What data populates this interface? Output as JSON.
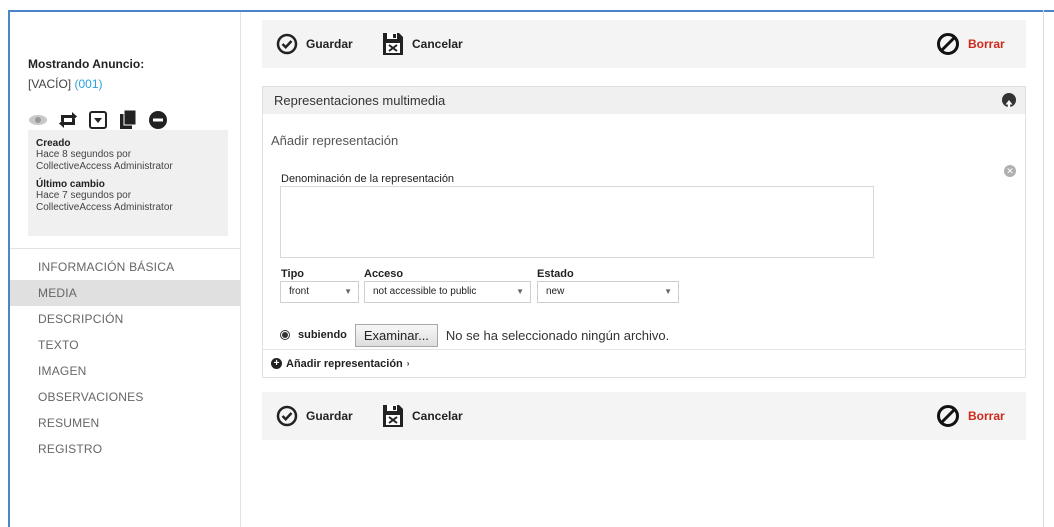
{
  "toolbar": {
    "save_label": "Guardar",
    "cancel_label": "Cancelar",
    "delete_label": "Borrar"
  },
  "sidebar": {
    "title": "Mostrando Anuncio:",
    "record_label": "[VACÍO]",
    "record_id": "(001)",
    "created_head": "Creado",
    "created_line1": "Hace 8 segundos por",
    "created_line2": "CollectiveAccess Administrator",
    "changed_head": "Último cambio",
    "changed_line1": "Hace 7 segundos por",
    "changed_line2": "CollectiveAccess Administrator",
    "nav": [
      "INFORMACIÓN BÁSICA",
      "MEDIA",
      "DESCRIPCIÓN",
      "TEXTO",
      "IMAGEN",
      "OBSERVACIONES",
      "RESUMEN",
      "REGISTRO"
    ],
    "active_nav": "MEDIA"
  },
  "panel": {
    "title": "Representaciones multimedia",
    "subtitle": "Añadir representación",
    "name_label": "Denominación de la representación",
    "name_value": "",
    "type_label": "Tipo",
    "type_value": "front",
    "access_label": "Acceso",
    "access_value": "not accessible to public",
    "status_label": "Estado",
    "status_value": "new",
    "upload_label": "subiendo",
    "browse_label": "Examinar...",
    "no_file_text": "No se ha seleccionado ningún archivo.",
    "add_link": "Añadir representación"
  },
  "colors": {
    "delete": "#d0281a",
    "accent_blue": "#2aa3d8",
    "frame": "#4a86c8"
  }
}
